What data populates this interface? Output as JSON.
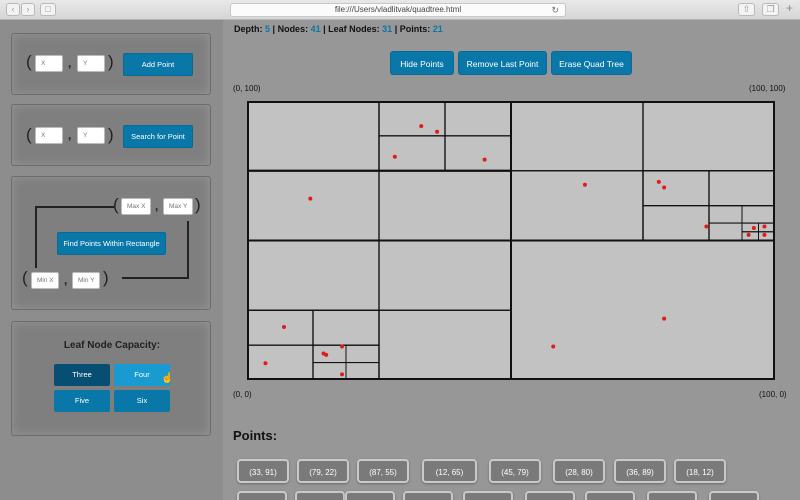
{
  "browser": {
    "url": "file:///Users/vladlitvak/quadtree.html"
  },
  "add_panel": {
    "x_placeholder": "X",
    "y_placeholder": "Y",
    "button": "Add Point"
  },
  "search_panel": {
    "x_placeholder": "X",
    "y_placeholder": "Y",
    "button": "Search for Point"
  },
  "range_panel": {
    "max_x_placeholder": "Max X",
    "max_y_placeholder": "Max Y",
    "min_x_placeholder": "Min X",
    "min_y_placeholder": "Min Y",
    "button": "Find Points Within Rectangle"
  },
  "capacity": {
    "title": "Leaf Node Capacity:",
    "options": [
      "Three",
      "Four",
      "Five",
      "Six"
    ],
    "selected": "Three",
    "hovered": "Four"
  },
  "stats": {
    "depth_label": "Depth:",
    "depth": "5",
    "nodes_label": "| Nodes:",
    "nodes": "41",
    "leaf_label": "| Leaf Nodes:",
    "leaf": "31",
    "points_label": "| Points:",
    "points": "21"
  },
  "toolbar": {
    "hide": "Hide Points",
    "remove": "Remove Last Point",
    "erase": "Erase Quad Tree"
  },
  "corners": {
    "top_left": "(0, 100)",
    "top_right": "(100, 100)",
    "bottom_left": "(0, 0)",
    "bottom_right": "(100, 0)"
  },
  "quadtree": {
    "xlim": [
      0,
      100
    ],
    "ylim": [
      0,
      100
    ],
    "point_color": "#e01b1b",
    "cells": [
      [
        0,
        50,
        50,
        100
      ],
      [
        50,
        50,
        100,
        100
      ],
      [
        0,
        75,
        50,
        100
      ],
      [
        0,
        50,
        50,
        75
      ],
      [
        0,
        75,
        25,
        100
      ],
      [
        25,
        75,
        50,
        100
      ],
      [
        25,
        87.5,
        37.5,
        100
      ],
      [
        37.5,
        87.5,
        50,
        100
      ],
      [
        25,
        75,
        37.5,
        87.5
      ],
      [
        37.5,
        75,
        50,
        87.5
      ],
      [
        0,
        50,
        25,
        75
      ],
      [
        25,
        50,
        50,
        75
      ],
      [
        50,
        75,
        75,
        100
      ],
      [
        75,
        75,
        100,
        100
      ],
      [
        50,
        50,
        75,
        75
      ],
      [
        75,
        50,
        100,
        75
      ],
      [
        75,
        62.5,
        87.5,
        75
      ],
      [
        87.5,
        62.5,
        100,
        75
      ],
      [
        75,
        50,
        87.5,
        62.5
      ],
      [
        87.5,
        50,
        100,
        62.5
      ],
      [
        87.5,
        56.25,
        93.75,
        62.5
      ],
      [
        93.75,
        56.25,
        100,
        62.5
      ],
      [
        87.5,
        50,
        93.75,
        56.25
      ],
      [
        93.75,
        50,
        100,
        56.25
      ],
      [
        93.75,
        53.125,
        96.875,
        56.25
      ],
      [
        96.875,
        53.125,
        100,
        56.25
      ],
      [
        93.75,
        50,
        96.875,
        53.125
      ],
      [
        96.875,
        50,
        100,
        53.125
      ],
      [
        0,
        0,
        50,
        50
      ],
      [
        50,
        0,
        100,
        50
      ],
      [
        0,
        25,
        25,
        50
      ],
      [
        25,
        25,
        50,
        50
      ],
      [
        0,
        0,
        25,
        25
      ],
      [
        25,
        0,
        50,
        25
      ],
      [
        0,
        12.5,
        12.5,
        25
      ],
      [
        12.5,
        12.5,
        25,
        25
      ],
      [
        0,
        0,
        12.5,
        12.5
      ],
      [
        12.5,
        0,
        25,
        12.5
      ],
      [
        12.5,
        6.25,
        18.75,
        12.5
      ],
      [
        18.75,
        6.25,
        25,
        12.5
      ],
      [
        12.5,
        0,
        18.75,
        6.25
      ],
      [
        18.75,
        0,
        25,
        6.25
      ]
    ],
    "points": [
      [
        33,
        91
      ],
      [
        36,
        89
      ],
      [
        28,
        80
      ],
      [
        45,
        79
      ],
      [
        12,
        65
      ],
      [
        64,
        70
      ],
      [
        78,
        71
      ],
      [
        79,
        69
      ],
      [
        87,
        55
      ],
      [
        95,
        52
      ],
      [
        98,
        55
      ],
      [
        96,
        54.5
      ],
      [
        98,
        52
      ],
      [
        79,
        22
      ],
      [
        58,
        12
      ],
      [
        7,
        19
      ],
      [
        15,
        9
      ],
      [
        3.5,
        6
      ],
      [
        18,
        12
      ],
      [
        14.5,
        9.5
      ],
      [
        18,
        2
      ]
    ]
  },
  "points_list": {
    "title": "Points:",
    "items": [
      "(33, 91)",
      "(79, 22)",
      "(87, 55)",
      "(12, 65)",
      "(45, 79)",
      "(28, 80)",
      "(36, 89)",
      "(18, 12)"
    ]
  }
}
